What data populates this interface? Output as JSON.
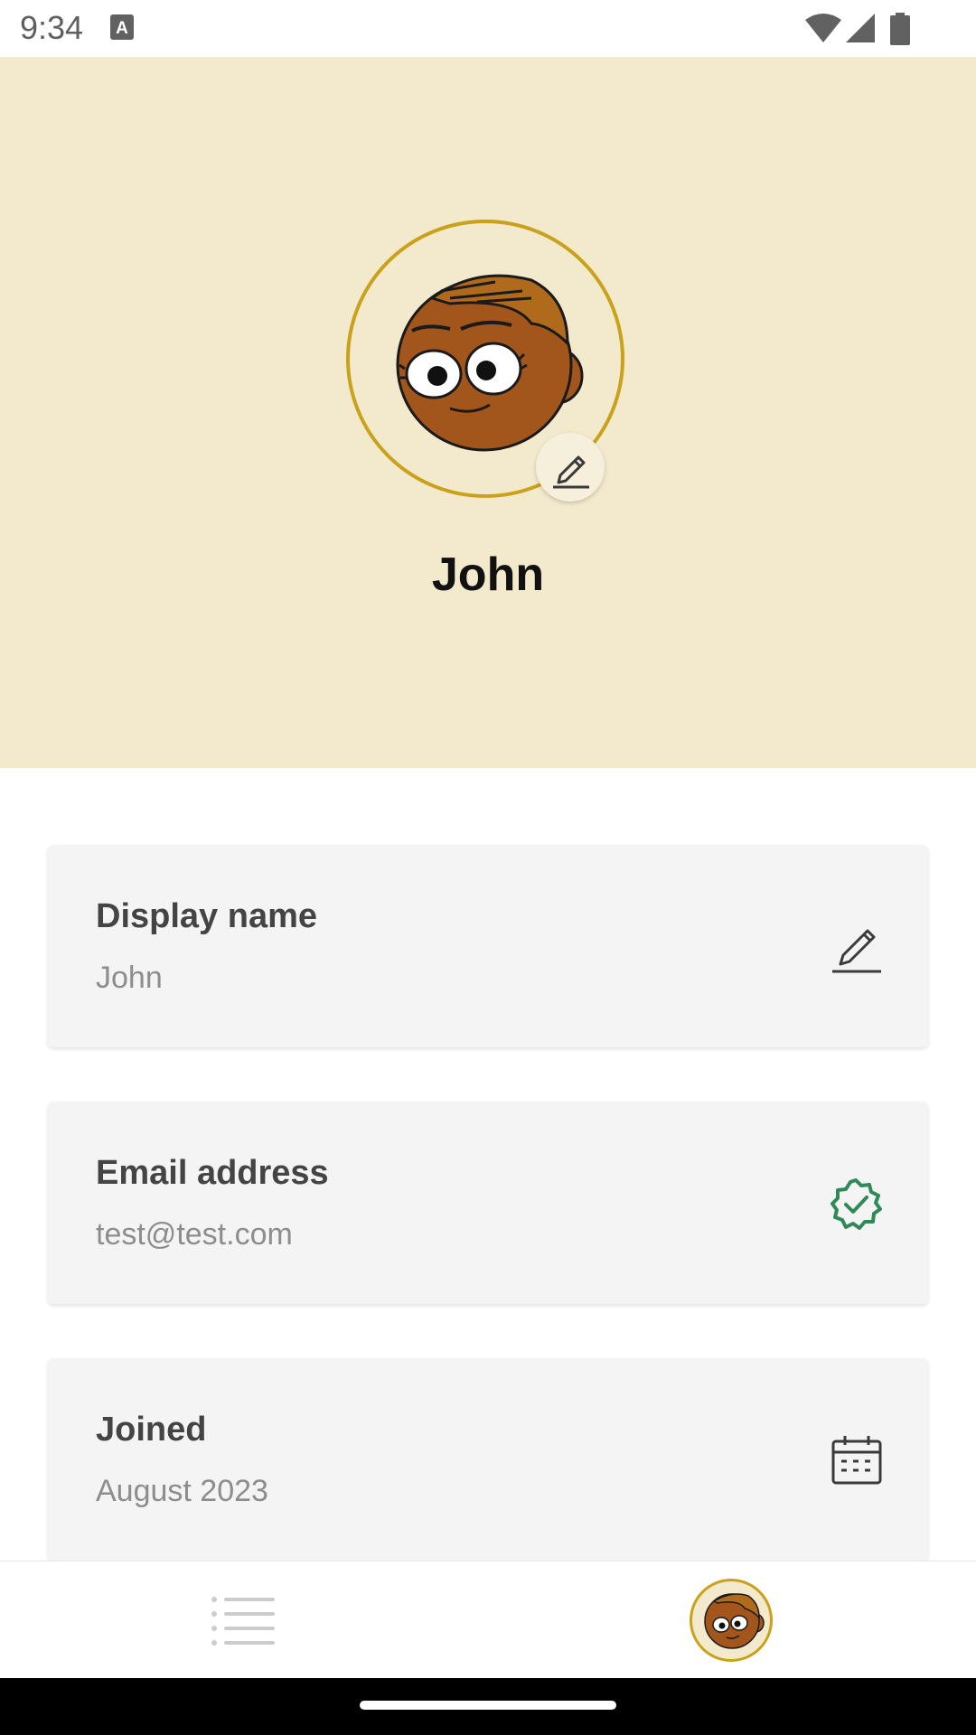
{
  "status_bar": {
    "time": "9:34"
  },
  "profile": {
    "name": "John"
  },
  "cards": [
    {
      "label": "Display name",
      "value": "John",
      "icon": "pencil-icon"
    },
    {
      "label": "Email address",
      "value": "test@test.com",
      "icon": "verified-badge-icon"
    },
    {
      "label": "Joined",
      "value": "August 2023",
      "icon": "calendar-icon"
    }
  ],
  "colors": {
    "header_bg": "#f3e9cd",
    "accent_ring": "#c9a21a",
    "verified_green": "#2e8b57"
  },
  "bottom_nav": {
    "items": [
      "list-icon",
      "profile-avatar"
    ]
  }
}
